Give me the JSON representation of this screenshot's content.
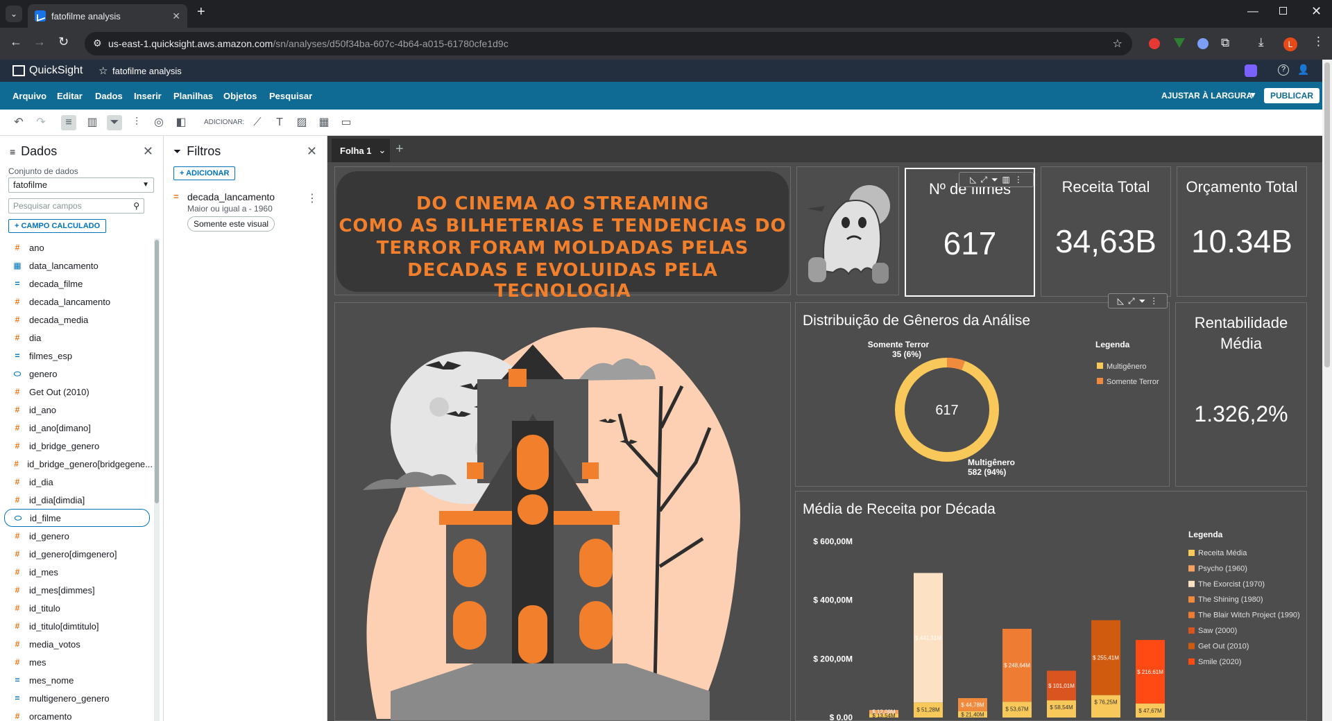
{
  "browser": {
    "tab_title": "fatofilme analysis",
    "tab_close": "✕",
    "new_tab": "+",
    "url_host": "us-east-1.quicksight.aws.amazon.com",
    "url_path": "/sn/analyses/d50f34ba-607c-4b64-a015-61780cfe1d9c",
    "profile_initial": "L"
  },
  "app": {
    "logo_text": "QuickSight",
    "analysis_name": "fatofilme analysis"
  },
  "menu": [
    "Arquivo",
    "Editar",
    "Dados",
    "Inserir",
    "Planilhas",
    "Objetos",
    "Pesquisar"
  ],
  "menu_right": {
    "fit_label": "AJUSTAR À LARGURA",
    "publish_label": "PUBLICAR"
  },
  "toolbar": {
    "add_label": "ADICIONAR:"
  },
  "data_panel": {
    "title": "Dados",
    "dataset_label": "Conjunto de dados",
    "dataset_value": "fatofilme",
    "search_placeholder": "Pesquisar campos",
    "calc_field_label": "CAMPO CALCULADO",
    "fields": [
      {
        "type": "num",
        "name": "ano"
      },
      {
        "type": "date",
        "name": "data_lancamento"
      },
      {
        "type": "dim",
        "name": "decada_filme"
      },
      {
        "type": "num",
        "name": "decada_lancamento"
      },
      {
        "type": "num",
        "name": "decada_media"
      },
      {
        "type": "num",
        "name": "dia"
      },
      {
        "type": "dim",
        "name": "filmes_esp"
      },
      {
        "type": "str",
        "name": "genero"
      },
      {
        "type": "num",
        "name": "Get Out (2010)"
      },
      {
        "type": "num",
        "name": "id_ano"
      },
      {
        "type": "num",
        "name": "id_ano[dimano]"
      },
      {
        "type": "num",
        "name": "id_bridge_genero"
      },
      {
        "type": "num",
        "name": "id_bridge_genero[bridgegene..."
      },
      {
        "type": "num",
        "name": "id_dia"
      },
      {
        "type": "num",
        "name": "id_dia[dimdia]"
      },
      {
        "type": "str",
        "name": "id_filme"
      },
      {
        "type": "num",
        "name": "id_genero"
      },
      {
        "type": "num",
        "name": "id_genero[dimgenero]"
      },
      {
        "type": "num",
        "name": "id_mes"
      },
      {
        "type": "num",
        "name": "id_mes[dimmes]"
      },
      {
        "type": "num",
        "name": "id_titulo"
      },
      {
        "type": "num",
        "name": "id_titulo[dimtitulo]"
      },
      {
        "type": "num",
        "name": "media_votos"
      },
      {
        "type": "num",
        "name": "mes"
      },
      {
        "type": "dim",
        "name": "mes_nome"
      },
      {
        "type": "dim",
        "name": "multigenero_genero"
      },
      {
        "type": "num",
        "name": "orcamento"
      }
    ]
  },
  "filter_panel": {
    "title": "Filtros",
    "add_label": "ADICIONAR",
    "filter_name": "decada_lancamento",
    "filter_condition": "Maior ou igual a - 1960",
    "filter_scope": "Somente este visual"
  },
  "sheet": {
    "tab_label": "Folha 1",
    "add_sheet": "+"
  },
  "banner": {
    "lines": [
      "DO CINEMA AO STREAMING",
      "COMO AS BILHETERIAS E TENDENCIAS DO",
      "TERROR FORAM MOLDADAS PELAS",
      "DECADAS E EVOLUIDAS PELA TECNOLOGIA"
    ]
  },
  "kpis": [
    {
      "title": "Nº de filmes",
      "value": "617"
    },
    {
      "title": "Receita Total",
      "value": "34,63B"
    },
    {
      "title": "Orçamento Total",
      "value": "10.34B"
    }
  ],
  "rentabilidade": {
    "title_line1": "Rentabilidade",
    "title_line2": "Média",
    "value": "1.326,2%"
  },
  "donut": {
    "title": "Distribuição de Gêneros da Análise",
    "center": "617",
    "legend_title": "Legenda",
    "label_terror_name": "Somente Terror",
    "label_terror_value": "35 (6%)",
    "label_multi_name": "Multigênero",
    "label_multi_value": "582 (94%)",
    "colors": {
      "multi": "#f9c85a",
      "terror": "#f08a3c"
    }
  },
  "chart_data": {
    "type": "bar",
    "title": "Média de Receita por Década",
    "legend_title": "Legenda",
    "ytick_labels": [
      "$ 600,00M",
      "$ 400,00M",
      "$ 200,00M",
      "$ 0,00"
    ],
    "ylim": [
      0,
      600
    ],
    "yunit": "M",
    "series": [
      {
        "name": "Receita Média",
        "color": "#f9c85a"
      },
      {
        "name": "Psycho (1960)",
        "color": "#f4a261"
      },
      {
        "name": "The Exorcist (1970)",
        "color": "#fde1c4"
      },
      {
        "name": "The Shining (1980)",
        "color": "#f08a3c"
      },
      {
        "name": "The Blair Witch Project (1990)",
        "color": "#ee7d33"
      },
      {
        "name": "Saw (2000)",
        "color": "#d9541e"
      },
      {
        "name": "Get Out (2010)",
        "color": "#d05a0e"
      },
      {
        "name": "Smile (2020)",
        "color": "#ff4a13"
      }
    ],
    "bars": [
      {
        "base": 13.54,
        "base_label": "$ 13,54M",
        "top": 12.09,
        "top_label": "$ 12,09M",
        "top_series": 1
      },
      {
        "base": 51.28,
        "base_label": "$ 51,28M",
        "top": 441.31,
        "top_label": "$ 441,31M",
        "top_series": 2
      },
      {
        "base": 21.4,
        "base_label": "$ 21,40M",
        "top": 44.78,
        "top_label": "$ 44,78M",
        "top_series": 3
      },
      {
        "base": 53.67,
        "base_label": "$ 53,67M",
        "top": 248.64,
        "top_label": "$ 248,64M",
        "top_series": 4
      },
      {
        "base": 58.54,
        "base_label": "$ 58,54M",
        "top": 101.01,
        "top_label": "$ 101,01M",
        "top_series": 5
      },
      {
        "base": 76.25,
        "base_label": "$ 76,25M",
        "top": 255.41,
        "top_label": "$ 255,41M",
        "top_series": 6
      },
      {
        "base": 47.67,
        "base_label": "$ 47,67M",
        "top": 216.61,
        "top_label": "$ 216,61M",
        "top_series": 7
      }
    ]
  }
}
